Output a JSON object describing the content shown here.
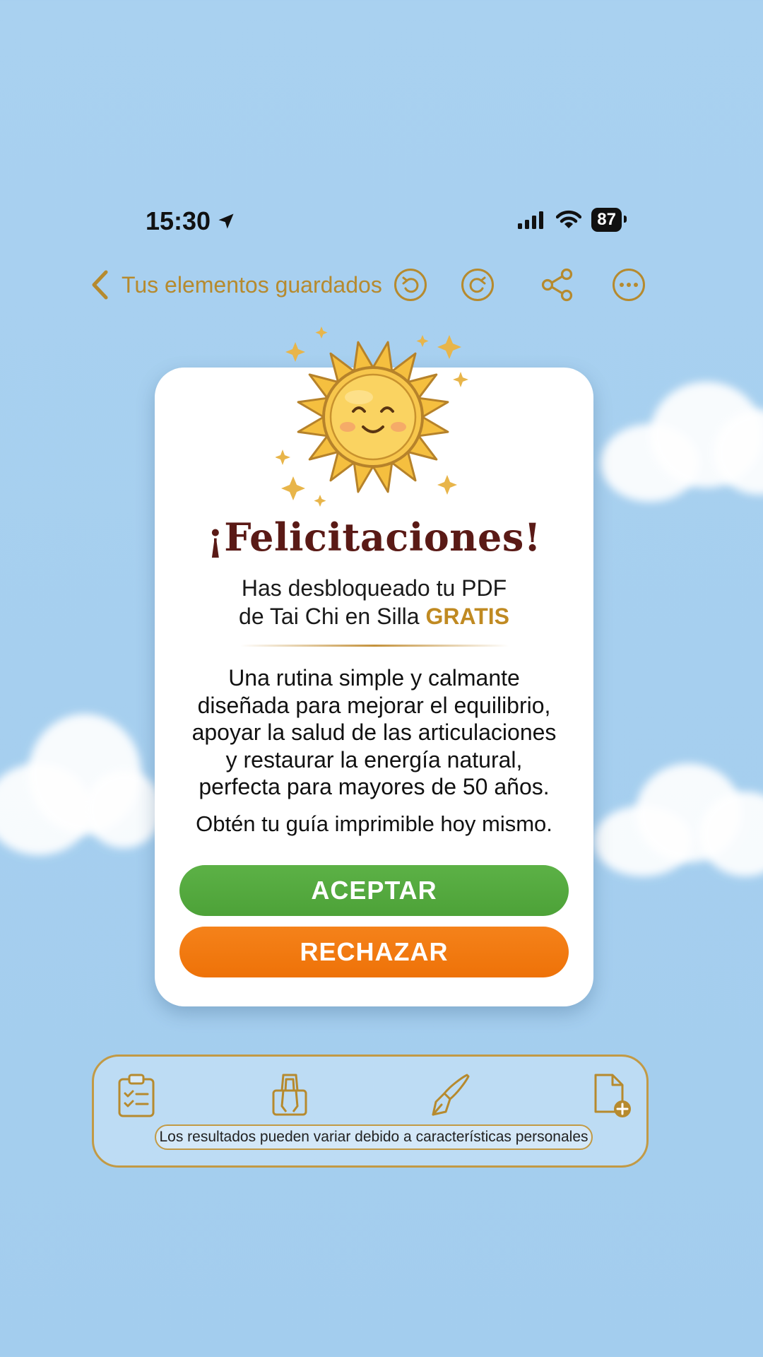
{
  "status_bar": {
    "time": "15:30",
    "battery": "87"
  },
  "nav": {
    "back_label": "Tus elementos guardados"
  },
  "card": {
    "title": "¡Felicitaciones!",
    "subtitle_line1": "Has desbloqueado tu PDF",
    "subtitle_line2": "de Tai Chi en Silla",
    "subtitle_highlight": "GRATIS",
    "description": [
      "Una rutina simple y calmante",
      "diseñada para mejorar el equilibrio,",
      "apoyar la salud de las articulaciones",
      "y restaurar la energía natural,",
      "perfecta para mayores de 50 años."
    ],
    "cta_line": "Obtén tu guía imprimible hoy mismo.",
    "accept_label": "ACEPTAR",
    "reject_label": "RECHAZAR"
  },
  "toolbar": {
    "disclaimer": "Los resultados pueden variar debido a características personales"
  },
  "icons": [
    "location-arrow-icon",
    "signal-icon",
    "wifi-icon",
    "battery-icon",
    "chevron-left-icon",
    "undo-icon",
    "redo-icon",
    "share-icon",
    "more-icon",
    "sun-icon",
    "sparkle-icon",
    "clipboard-checklist-icon",
    "binder-clip-icon",
    "pen-nib-icon",
    "file-add-icon"
  ],
  "colors": {
    "accent_gold": "#b68a2e",
    "title_maroon": "#5a1a16",
    "accept_green": "#52a83c",
    "reject_orange": "#f07a0e",
    "sky": "#a6cfef"
  }
}
